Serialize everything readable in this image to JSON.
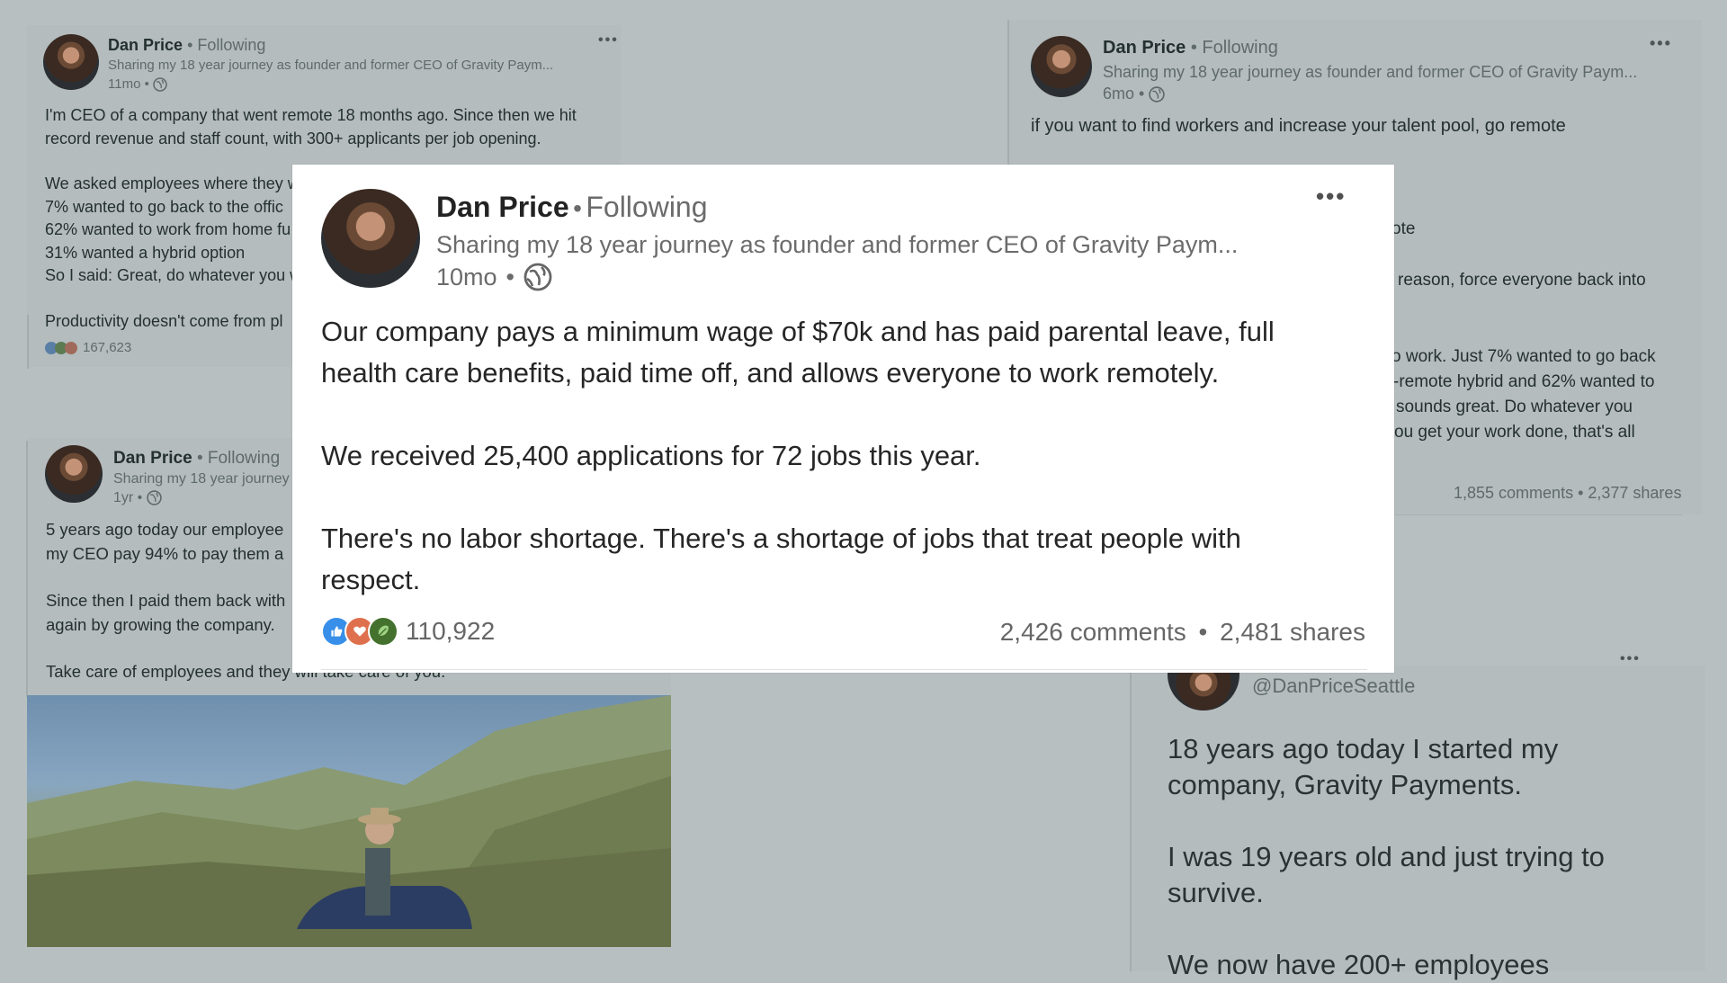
{
  "posts": {
    "top_left": {
      "author": "Dan Price",
      "follow": "Following",
      "headline": "Sharing my 18 year journey as founder and former CEO of Gravity Paym...",
      "age": "11mo",
      "lines": [
        "I'm CEO of a company that went remote 18 months ago. Since then we hit",
        "record revenue and staff count, with 300+ applicants per job opening.",
        "",
        "We asked employees where they w",
        "7% wanted to go back to the offic",
        "62% wanted to work from home fu",
        "31% wanted a hybrid option",
        "So I said: Great, do whatever you w",
        "",
        "Productivity doesn't come from pl"
      ],
      "reactions_count": "167,623"
    },
    "top_right": {
      "author": "Dan Price",
      "follow": "Following",
      "headline": "Sharing my 18 year journey as founder and former CEO of Gravity Paym...",
      "age": "6mo",
      "first_line": "if you want to find workers and increase your talent pool, go remote",
      "fragments": [
        "ote",
        "reason, force everyone back into",
        "o work. Just 7% wanted to go back",
        "-remote hybrid and 62% wanted to",
        "sounds great. Do whatever you",
        "ou get your work done, that's all"
      ],
      "stats": "1,855 comments • 2,377 shares"
    },
    "bottom_left": {
      "author": "Dan Price",
      "follow": "Following",
      "headline": "Sharing my 18 year journey",
      "age": "1yr",
      "lines": [
        "5 years ago today our employee",
        "my CEO pay 94% to pay them a",
        "",
        "Since then I paid them back with",
        "again by growing the company.",
        "",
        "Take care of employees and they will take care of you."
      ]
    },
    "bottom_right": {
      "handle": "@DanPriceSeattle",
      "lines": [
        "18 years ago today I started my",
        "company, Gravity Payments.",
        "",
        "I was 19 years old and just trying to",
        "survive.",
        "",
        "We now have 200+ employees"
      ]
    }
  },
  "main_post": {
    "author": "Dan Price",
    "follow": "Following",
    "headline": "Sharing my 18 year journey as founder and former CEO of Gravity Paym...",
    "age": "10mo",
    "paragraphs": [
      "Our company pays a minimum wage of $70k and has paid parental leave, full",
      "health care benefits, paid time off, and allows everyone to work remotely.",
      "We received 25,400 applications for 72 jobs this year.",
      "There's no labor shortage. There's a shortage of jobs that treat people with",
      "respect."
    ],
    "reactions_count": "110,922",
    "comments": "2,426 comments",
    "shares": "2,481 shares",
    "separator": "•",
    "more": "•••"
  },
  "icons": {
    "more": "more-options-icon",
    "globe": "globe-icon",
    "like": "like-reaction-icon",
    "love": "love-reaction-icon",
    "insightful": "insightful-reaction-icon"
  },
  "colors": {
    "backdrop": "#b7bfc0",
    "popup": "#ffffff",
    "like": "#378fe9",
    "love": "#df704d",
    "insightful": "#44712e"
  }
}
